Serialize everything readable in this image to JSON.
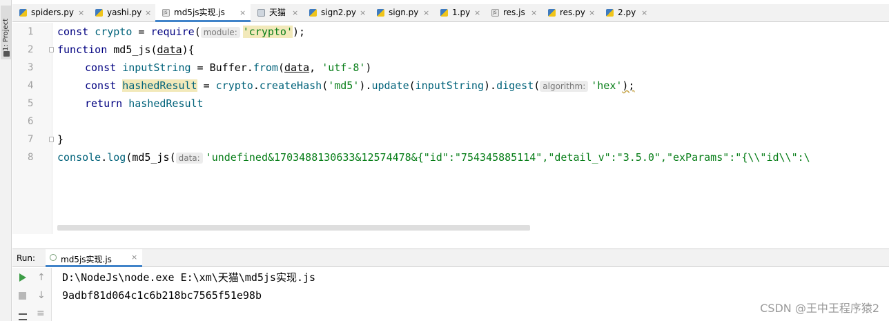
{
  "tool_window": {
    "project_label": "1: Project"
  },
  "tabs": [
    {
      "name": "spiders.py",
      "type": "py",
      "active": false
    },
    {
      "name": "yashi.py",
      "type": "py",
      "active": false
    },
    {
      "name": "md5js实现.js",
      "type": "js",
      "active": true
    },
    {
      "name": "天猫",
      "type": "txt",
      "active": false
    },
    {
      "name": "sign2.py",
      "type": "py",
      "active": false
    },
    {
      "name": "sign.py",
      "type": "py",
      "active": false
    },
    {
      "name": "1.py",
      "type": "py",
      "active": false
    },
    {
      "name": "res.js",
      "type": "js",
      "active": false
    },
    {
      "name": "res.py",
      "type": "py",
      "active": false
    },
    {
      "name": "2.py",
      "type": "py",
      "active": false
    }
  ],
  "tab_close_glyph": "×",
  "editor": {
    "line_numbers": [
      "1",
      "2",
      "3",
      "4",
      "5",
      "6",
      "7",
      "8"
    ],
    "line1": {
      "a": "const ",
      "b": "crypto",
      "c": " = ",
      "d": "require",
      "e": "(",
      "hint": "module:",
      "f": "'crypto'",
      "g": ");"
    },
    "line2": {
      "a": "function ",
      "b": "md5_js",
      "c": "(",
      "d": "data",
      "e": "){"
    },
    "line3": {
      "a": "const ",
      "b": "inputString",
      "c": " = Buffer.",
      "d": "from",
      "e": "(",
      "f": "data",
      "g": ", ",
      "h": "'utf-8'",
      "i": ")"
    },
    "line4": {
      "a": "const ",
      "b": "hashedResult",
      "c": " = ",
      "d": "crypto",
      "e": ".",
      "f": "createHash",
      "g": "(",
      "h": "'md5'",
      "i": ").",
      "j": "update",
      "k": "(",
      "l": "inputString",
      "m": ").",
      "n": "digest",
      "o": "(",
      "hint": "algorithm:",
      "p": "'hex'",
      "q": ");"
    },
    "line5": {
      "a": "return ",
      "b": "hashedResult"
    },
    "line7": {
      "a": "}"
    },
    "line8": {
      "a": "console",
      "b": ".",
      "c": "log",
      "d": "(",
      "e": "md5_js",
      "f": "(",
      "hint": "data:",
      "g": "'undefined&1703488130633&12574478&{\"id\":\"754345885114\",\"detail_v\":\"3.5.0\",\"exParams\":\"{\\\\\"id\\\\\":\\"
    }
  },
  "run_panel": {
    "label": "Run:",
    "tab_name": "md5js实现.js",
    "output": [
      "D:\\NodeJs\\node.exe E:\\xm\\天猫\\md5js实现.js",
      "9adbf81d064c1c6b218bc7565f51e98b"
    ]
  },
  "watermark": "CSDN @王中王程序猿2",
  "colors": {
    "accent": "#4083c9",
    "keyword": "#000080",
    "function": "#00627a",
    "string": "#067d17",
    "run_green": "#3c9c46"
  }
}
